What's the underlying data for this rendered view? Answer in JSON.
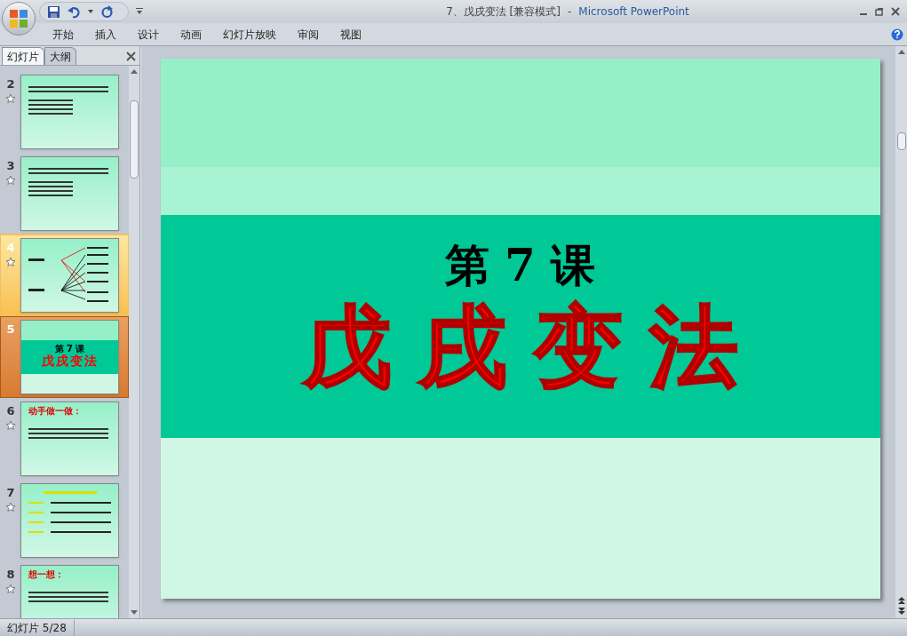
{
  "window": {
    "title": "7、戊戌变法 [兼容模式]",
    "separator": "-",
    "app": "Microsoft PowerPoint"
  },
  "ribbon_tabs": [
    {
      "label": "开始",
      "selected": false
    },
    {
      "label": "插入",
      "selected": false
    },
    {
      "label": "设计",
      "selected": false
    },
    {
      "label": "动画",
      "selected": false
    },
    {
      "label": "幻灯片放映",
      "selected": false
    },
    {
      "label": "审阅",
      "selected": false
    },
    {
      "label": "视图",
      "selected": false
    }
  ],
  "panel_tabs": [
    {
      "label": "幻灯片",
      "selected": true
    },
    {
      "label": "大纲",
      "selected": false
    }
  ],
  "thumbnails": [
    {
      "number": "2",
      "kind": "quiz",
      "selected": false,
      "hovered": false,
      "has_animation": true
    },
    {
      "number": "3",
      "kind": "quiz",
      "selected": false,
      "hovered": false,
      "has_animation": true
    },
    {
      "number": "4",
      "kind": "diagram",
      "selected": false,
      "hovered": true,
      "has_animation": true
    },
    {
      "number": "5",
      "kind": "title",
      "selected": true,
      "hovered": false,
      "has_animation": false,
      "heading": "第 7 课",
      "title": "戊戌变法"
    },
    {
      "number": "6",
      "kind": "text",
      "selected": false,
      "hovered": false,
      "has_animation": true,
      "heading": "动手做一做："
    },
    {
      "number": "7",
      "kind": "table",
      "selected": false,
      "hovered": false,
      "has_animation": true
    },
    {
      "number": "8",
      "kind": "text",
      "selected": false,
      "hovered": false,
      "has_animation": true,
      "heading": "想一想："
    }
  ],
  "slide": {
    "heading": "第 7 课",
    "title": "戊戌变法"
  },
  "status_bar": {
    "slide_counter": "幻灯片 5/28"
  }
}
